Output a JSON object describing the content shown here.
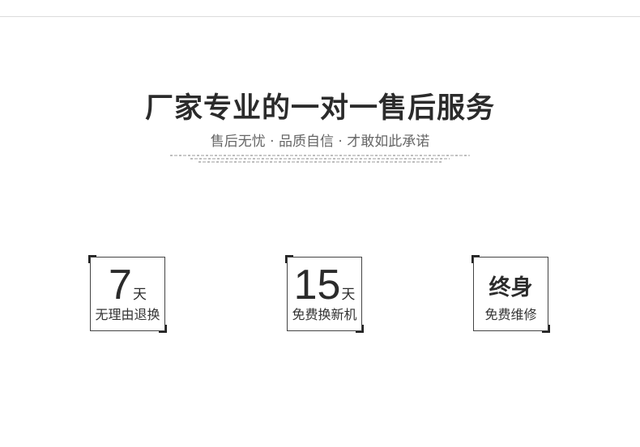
{
  "header": {
    "title": "厂家专业的一对一售后服务",
    "subtitle": "售后无忧 · 品质自信 · 才敢如此承诺"
  },
  "badges": [
    {
      "number": "7",
      "unit": "天",
      "label": "无理由退换"
    },
    {
      "number": "15",
      "unit": "天",
      "label": "免费换新机"
    },
    {
      "big": "终身",
      "label": "免费维修"
    }
  ]
}
